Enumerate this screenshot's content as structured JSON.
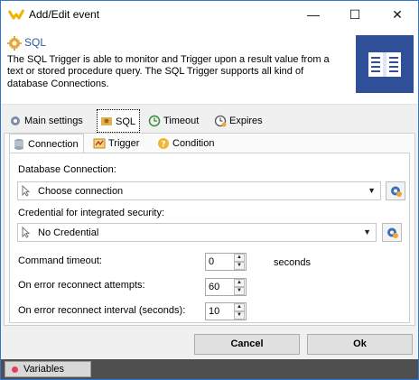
{
  "window": {
    "title": "Add/Edit event",
    "minimize": "—",
    "maximize": "☐",
    "close": "✕"
  },
  "header": {
    "title": "SQL",
    "description": "The SQL Trigger is able to monitor and Trigger upon a result value from a text or stored procedure query. The SQL Trigger supports all kind of database Connections."
  },
  "main_tabs": [
    "Main settings",
    "SQL",
    "Timeout",
    "Expires"
  ],
  "sub_tabs": [
    "Connection",
    "Trigger",
    "Condition"
  ],
  "connection": {
    "db_label": "Database Connection:",
    "db_value": "Choose connection",
    "cred_label": "Credential for integrated security:",
    "cred_value": "No Credential",
    "timeout_label": "Command timeout:",
    "timeout_value": "0",
    "timeout_unit": "seconds",
    "attempts_label": "On error reconnect attempts:",
    "attempts_value": "60",
    "interval_label": "On error reconnect interval (seconds):",
    "interval_value": "10"
  },
  "buttons": {
    "cancel": "Cancel",
    "ok": "Ok"
  },
  "status": {
    "variables": "Variables"
  },
  "colors": {
    "accent_blue": "#2f4f99",
    "title_blue": "#2d58a7",
    "statusbar": "#4f4f4f"
  }
}
